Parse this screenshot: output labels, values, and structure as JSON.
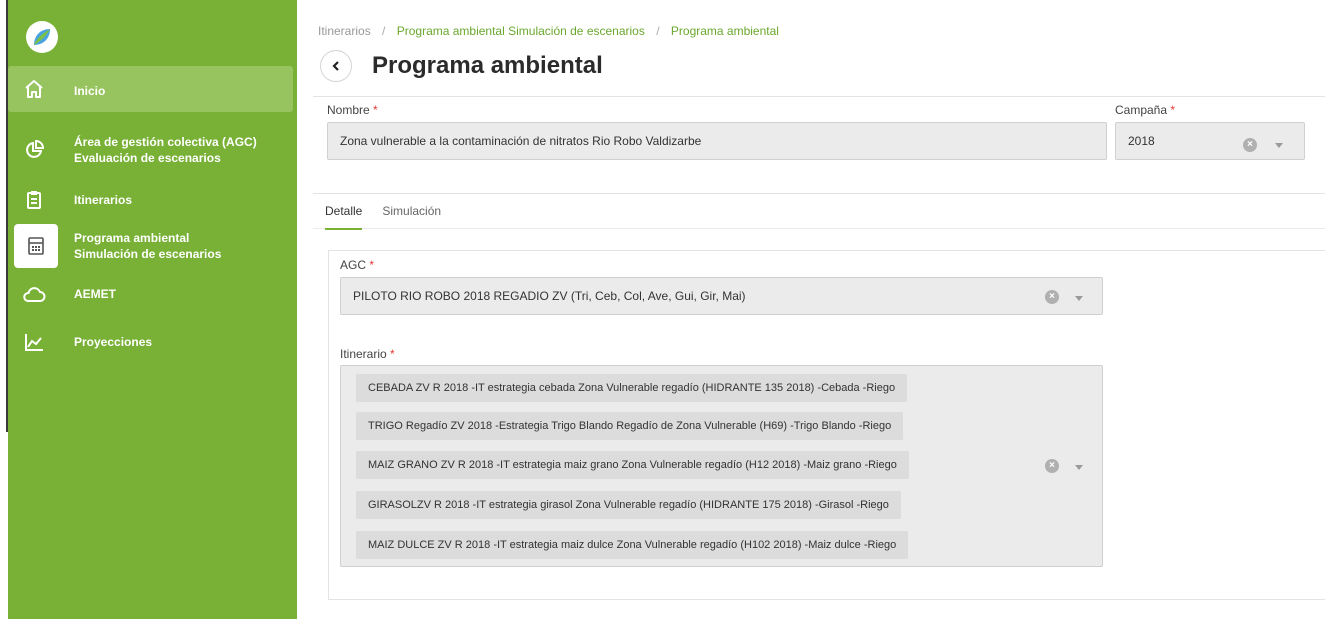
{
  "sidebar": {
    "items": [
      {
        "label_lines": [
          "Inicio"
        ],
        "icon": "home-icon"
      },
      {
        "label_lines": [
          "Área de gestión colectiva (AGC)",
          "Evaluación de escenarios"
        ],
        "icon": "pie-chart-icon"
      },
      {
        "label_lines": [
          "Itinerarios"
        ],
        "icon": "clipboard-icon"
      },
      {
        "label_lines": [
          "Programa ambiental",
          "Simulación de escenarios"
        ],
        "icon": "calculator-icon"
      },
      {
        "label_lines": [
          "AEMET"
        ],
        "icon": "cloud-icon"
      },
      {
        "label_lines": [
          "Proyecciones"
        ],
        "icon": "area-chart-icon"
      }
    ],
    "active_index": 0,
    "accent": "#78b136"
  },
  "breadcrumb": {
    "items": [
      "Itinerarios",
      "Programa ambiental Simulación de escenarios",
      "Programa ambiental"
    ],
    "separator": "/"
  },
  "page": {
    "title": "Programa ambiental"
  },
  "form": {
    "nombre_label": "Nombre",
    "nombre_value": "Zona vulnerable a la contaminación de nitratos Rio Robo Valdizarbe",
    "campana_label": "Campaña",
    "campana_value": "2018",
    "required_mark": "*"
  },
  "tabs": [
    {
      "label": "Detalle",
      "active": true
    },
    {
      "label": "Simulación",
      "active": false
    }
  ],
  "detail": {
    "agc_label": "AGC",
    "agc_value": "PILOTO RIO ROBO 2018 REGADIO ZV (Tri, Ceb, Col, Ave, Gui, Gir, Mai)",
    "itinerario_label": "Itinerario",
    "itinerarios": [
      "CEBADA ZV R 2018 -IT estrategia cebada Zona Vulnerable regadío (HIDRANTE 135 2018) -Cebada -Riego",
      "TRIGO Regadío ZV 2018 -Estrategia Trigo Blando Regadío de Zona Vulnerable (H69) -Trigo Blando -Riego",
      "MAIZ GRANO ZV R 2018 -IT estrategia maiz grano Zona Vulnerable regadío (H12 2018) -Maiz grano -Riego",
      "GIRASOLZV R 2018 -IT estrategia girasol Zona Vulnerable regadío (HIDRANTE 175 2018) -Girasol -Riego",
      "MAIZ DULCE ZV R 2018 -IT estrategia maiz dulce Zona Vulnerable regadío (H102 2018) -Maiz dulce -Riego"
    ]
  }
}
